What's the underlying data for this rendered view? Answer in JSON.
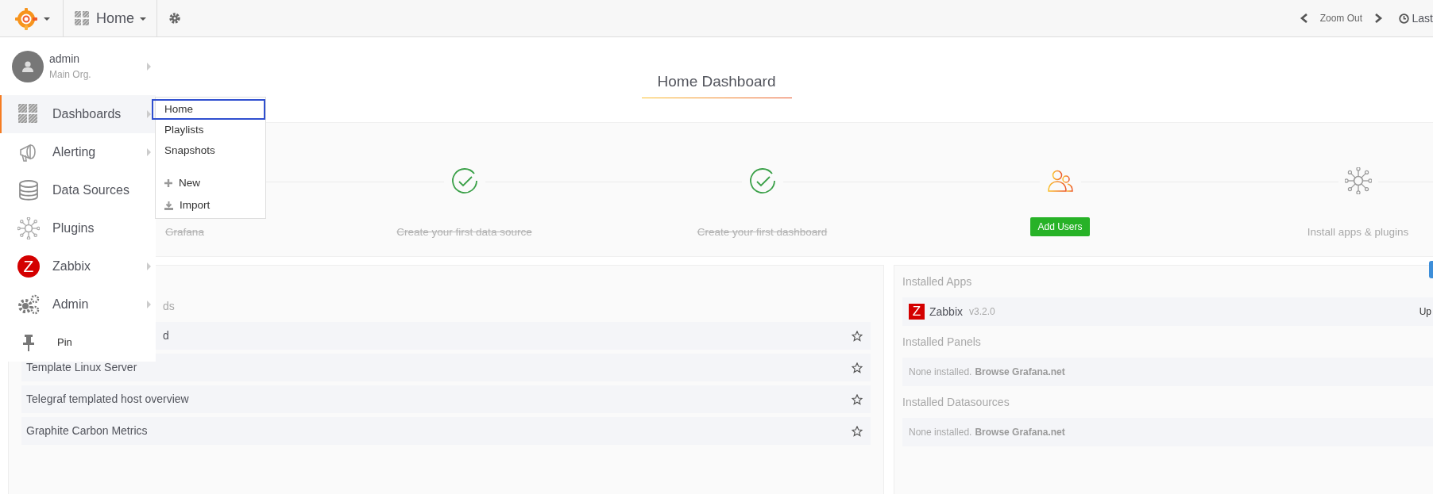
{
  "topbar": {
    "dashboard_title": "Home",
    "zoom_label": "Zoom Out",
    "time_label": "Last"
  },
  "sidebar": {
    "user": {
      "name": "admin",
      "org": "Main Org."
    },
    "items": [
      {
        "label": "Dashboards",
        "selected": true,
        "has_submenu": true
      },
      {
        "label": "Alerting",
        "selected": false,
        "has_submenu": true
      },
      {
        "label": "Data Sources",
        "selected": false,
        "has_submenu": false
      },
      {
        "label": "Plugins",
        "selected": false,
        "has_submenu": false
      },
      {
        "label": "Zabbix",
        "icon_letter": "Z",
        "selected": false,
        "has_submenu": true
      },
      {
        "label": "Admin",
        "selected": false,
        "has_submenu": true
      }
    ],
    "pin_label": "Pin"
  },
  "submenu": [
    {
      "kind": "link",
      "label": "Home",
      "selected": true
    },
    {
      "kind": "link",
      "label": "Playlists",
      "selected": false
    },
    {
      "kind": "link",
      "label": "Snapshots",
      "selected": false
    },
    {
      "kind": "action",
      "label": "New",
      "selected": false
    },
    {
      "kind": "action",
      "label": "Import",
      "selected": false
    }
  ],
  "page_title": "Home Dashboard",
  "steps": [
    {
      "kind": "done",
      "label": "Grafana"
    },
    {
      "kind": "done",
      "label": "Create your first data source"
    },
    {
      "kind": "done",
      "label": "Create your first dashboard"
    },
    {
      "kind": "current",
      "label": "Add Users"
    },
    {
      "kind": "todo",
      "label": "Install apps & plugins"
    }
  ],
  "dashboards": {
    "heading": "ds",
    "rows": [
      {
        "title": "d",
        "starred": false
      },
      {
        "title": "Template Linux Server",
        "starred": false
      },
      {
        "title": "Telegraf templated host overview",
        "starred": false
      },
      {
        "title": "Graphite Carbon Metrics",
        "starred": false
      }
    ]
  },
  "plugins": [
    {
      "title": "Installed Apps",
      "items": [
        {
          "kind": "app",
          "icon_letter": "Z",
          "name": "Zabbix",
          "version": "v3.2.0",
          "action": "Up"
        }
      ]
    },
    {
      "title": "Installed Panels",
      "items": [
        {
          "kind": "empty",
          "text": "None installed.",
          "link": "Browse Grafana.net"
        }
      ]
    },
    {
      "title": "Installed Datasources",
      "items": [
        {
          "kind": "empty",
          "text": "None installed.",
          "link": "Browse Grafana.net"
        }
      ]
    }
  ]
}
